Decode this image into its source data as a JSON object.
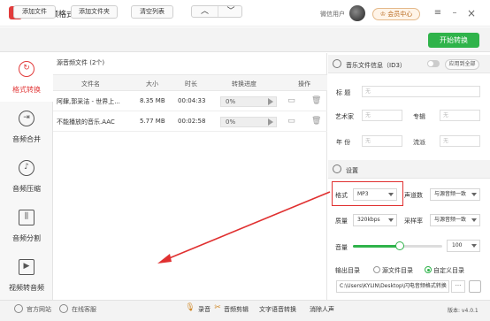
{
  "window": {
    "title": "闪电音频格式转换器",
    "user_label": "微信用户",
    "vip_label": "会员中心"
  },
  "toolbar": {
    "add_file": "添加文件",
    "add_folder": "添加文件夹",
    "clear_list": "清空列表",
    "start": "开始转换"
  },
  "sidebar": {
    "items": [
      {
        "label": "格式转换",
        "icon": "refresh-icon",
        "active": true
      },
      {
        "label": "音频合并",
        "icon": "merge-icon",
        "active": false
      },
      {
        "label": "音频压缩",
        "icon": "music-note-icon",
        "active": false
      },
      {
        "label": "音频分割",
        "icon": "split-icon",
        "active": false
      },
      {
        "label": "视频转音频",
        "icon": "play-icon",
        "active": false
      }
    ]
  },
  "file_list": {
    "header": "源音频文件 (2个)",
    "columns": [
      "文件名",
      "大小",
      "时长",
      "转换进度",
      "操作"
    ],
    "rows": [
      {
        "name": "阿肆,郭采洁 - 世界上...",
        "size": "8.35 MB",
        "duration": "00:04:33",
        "progress_text": "0%",
        "progress": 0
      },
      {
        "name": "不能播放的音乐.AAC",
        "size": "5.77 MB",
        "duration": "00:02:58",
        "progress_text": "0%",
        "progress": 0
      }
    ]
  },
  "id3": {
    "title": "音乐文件信息（ID3）",
    "apply_all": "应用到全部",
    "fields": {
      "title_label": "标 题",
      "title_value": "无",
      "artist_label": "艺术家",
      "artist_value": "无",
      "album_label": "专辑",
      "album_value": "无",
      "year_label": "年 份",
      "year_value": "无",
      "genre_label": "流派",
      "genre_value": "无"
    }
  },
  "settings": {
    "title": "设置",
    "format_label": "格式",
    "format_value": "MP3",
    "channel_label": "声道数",
    "channel_value": "与源音频一致",
    "quality_label": "质量",
    "quality_value": "320kbps",
    "samplerate_label": "采样率",
    "samplerate_value": "与源音频一致",
    "volume_label": "音量",
    "volume_value": "100",
    "volume_level": 0.52,
    "output_label": "输出目录",
    "output_option_source": "源文件目录",
    "output_option_custom": "自定义目录",
    "output_selected": "custom",
    "output_path": "C:\\Users\\KYLIN\\Desktop\\闪电音频格式转换",
    "browse_label": "···"
  },
  "bottom": {
    "website": "官方网站",
    "support": "在线客服",
    "tools": [
      "录音",
      "音频剪辑",
      "文字语音转换",
      "消除人声"
    ],
    "version": "版本: v4.0.1"
  },
  "colors": {
    "accent_red": "#e23b3b",
    "accent_green": "#2fb34a",
    "highlight_box": "#e03030"
  }
}
